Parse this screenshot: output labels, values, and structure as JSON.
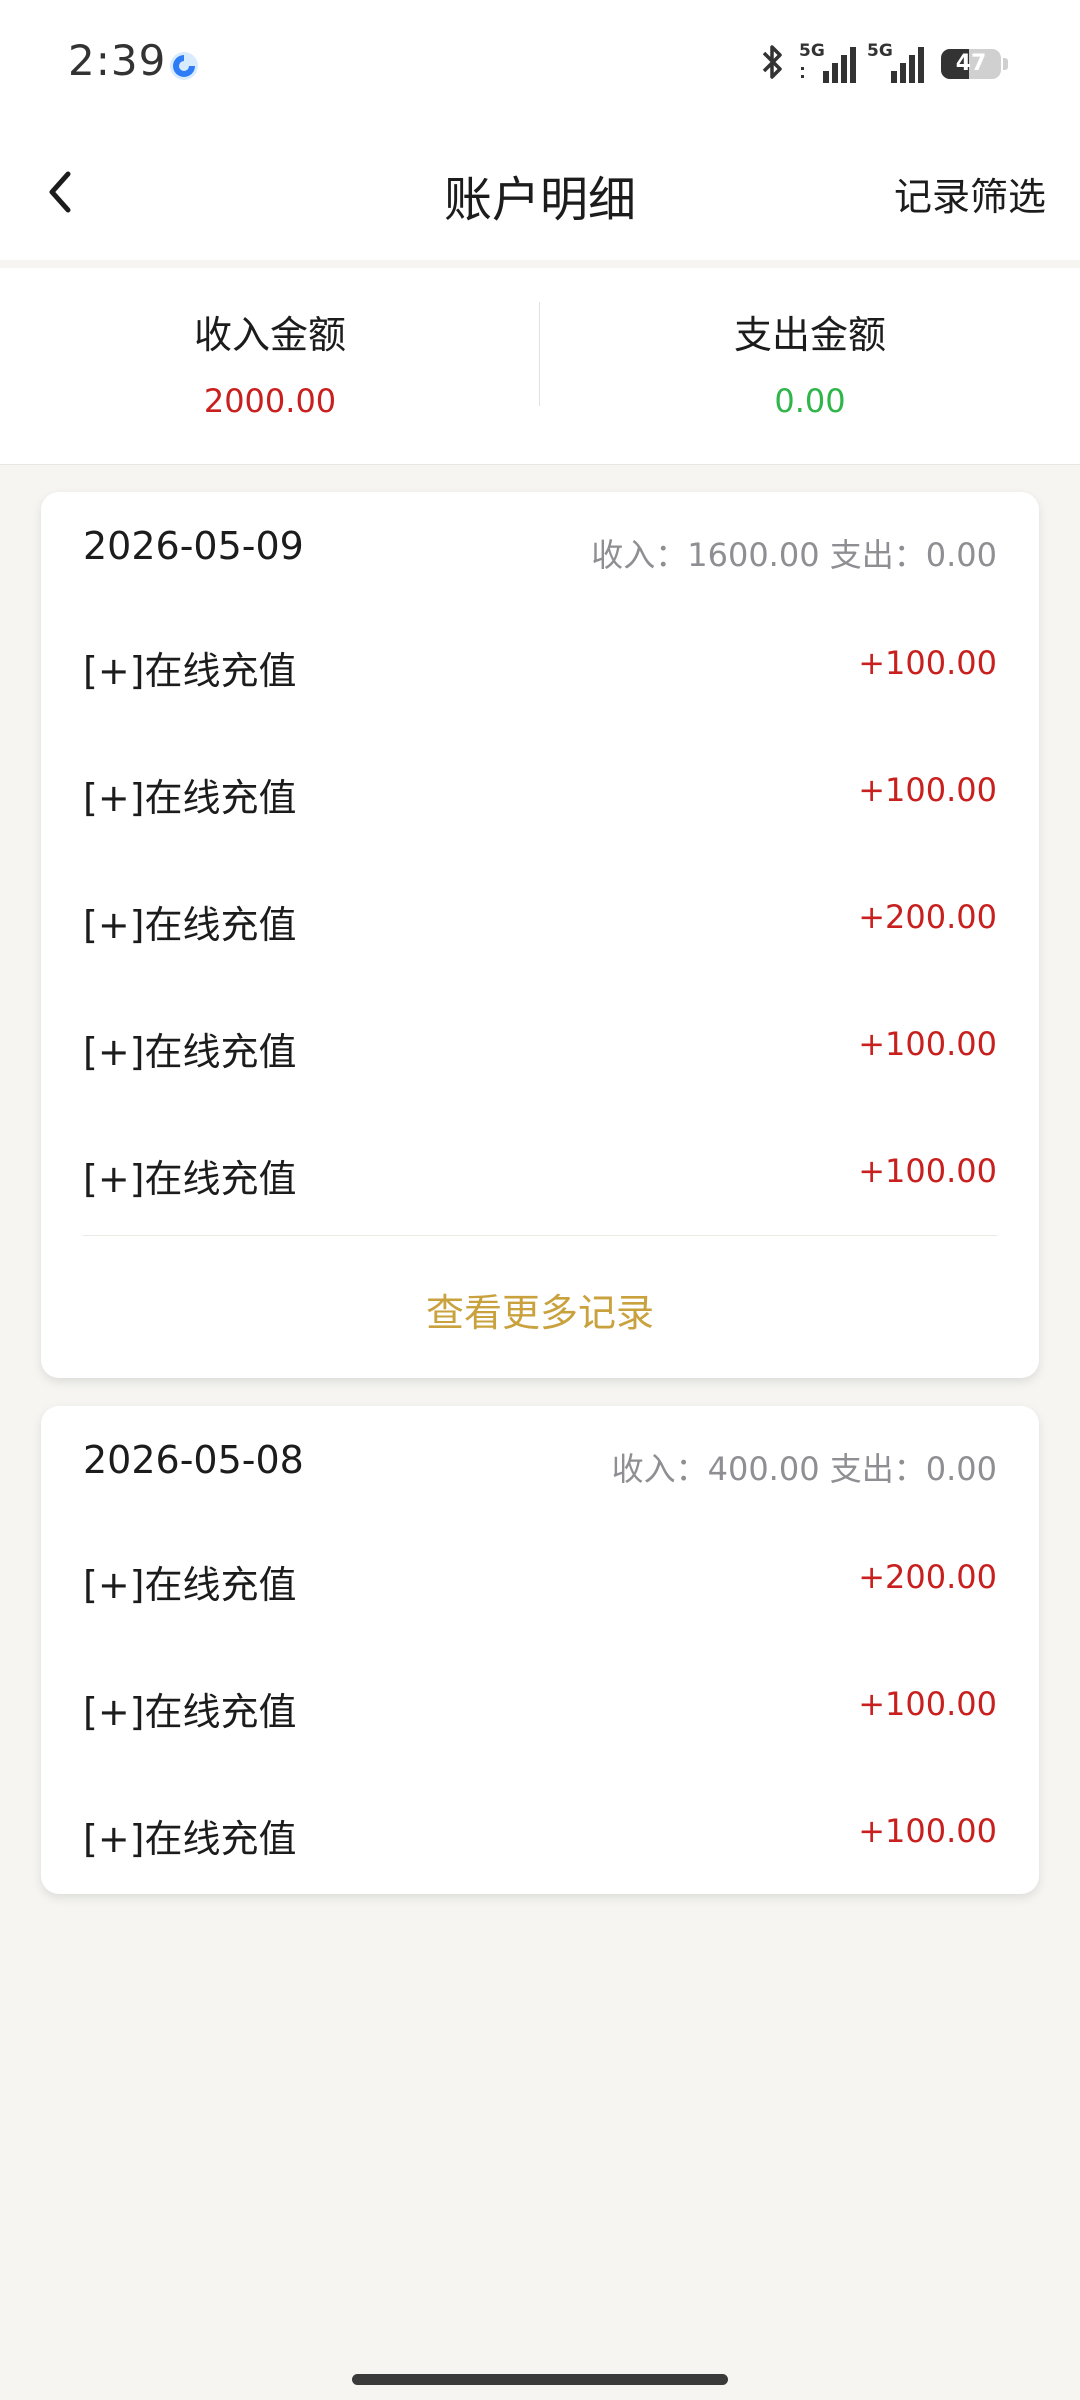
{
  "status_bar": {
    "time": "2:39",
    "network_1": "5G",
    "network_2": "5G",
    "battery": "47",
    "battery_level": 0.47
  },
  "header": {
    "title": "账户明细",
    "filter_label": "记录筛选"
  },
  "summary": {
    "income_label": "收入金额",
    "income_value": "2000.00",
    "expense_label": "支出金额",
    "expense_value": "0.00"
  },
  "colors": {
    "income": "#c8201e",
    "expense": "#2fb54a",
    "accent": "#c9a23e"
  },
  "groups": [
    {
      "date": "2026-05-09",
      "summary": "收入：1600.00 支出：0.00",
      "items": [
        {
          "title": "[+]在线充值",
          "amount": "+100.00"
        },
        {
          "title": "[+]在线充值",
          "amount": "+100.00"
        },
        {
          "title": "[+]在线充值",
          "amount": "+200.00"
        },
        {
          "title": "[+]在线充值",
          "amount": "+100.00"
        },
        {
          "title": "[+]在线充值",
          "amount": "+100.00"
        }
      ],
      "more_label": "查看更多记录"
    },
    {
      "date": "2026-05-08",
      "summary": "收入：400.00 支出：0.00",
      "items": [
        {
          "title": "[+]在线充值",
          "amount": "+200.00"
        },
        {
          "title": "[+]在线充值",
          "amount": "+100.00"
        },
        {
          "title": "[+]在线充值",
          "amount": "+100.00"
        }
      ]
    }
  ]
}
